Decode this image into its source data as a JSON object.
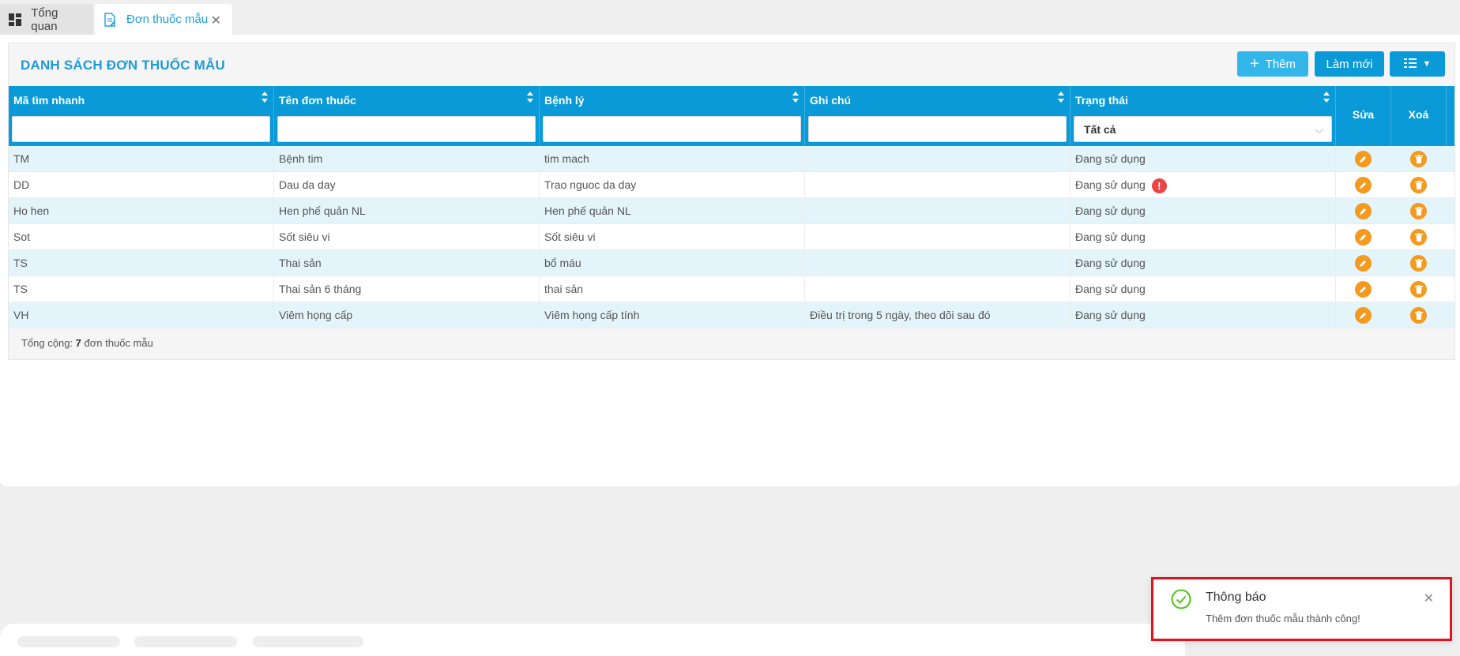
{
  "tabs": [
    {
      "label": "Tổng quan",
      "icon": "dashboard-icon"
    },
    {
      "label": "Đơn thuốc mẫu",
      "icon": "document-edit-icon",
      "active": true
    }
  ],
  "page": {
    "title": "DANH SÁCH ĐƠN THUỐC MẪU",
    "add_label": "Thêm",
    "refresh_label": "Làm mới"
  },
  "table": {
    "columns": {
      "code": "Mã tìm nhanh",
      "name": "Tên đơn thuốc",
      "disease": "Bệnh lý",
      "note": "Ghi chú",
      "status": "Trạng thái",
      "edit": "Sửa",
      "delete": "Xoá"
    },
    "status_filter": "Tất cả",
    "rows": [
      {
        "code": "TM",
        "name": "Bệnh tim",
        "disease": "tim mach",
        "note": "",
        "status": "Đang sử dụng",
        "warning": false
      },
      {
        "code": "DD",
        "name": "Dau da day",
        "disease": "Trao nguoc da day",
        "note": "",
        "status": "Đang sử dụng",
        "warning": true
      },
      {
        "code": "Ho hen",
        "name": "Hen phế quản NL",
        "disease": "Hen phế quản NL",
        "note": "",
        "status": "Đang sử dụng",
        "warning": false
      },
      {
        "code": "Sot",
        "name": "Sốt siêu vi",
        "disease": "Sốt siêu vi",
        "note": "",
        "status": "Đang sử dụng",
        "warning": false
      },
      {
        "code": "TS",
        "name": "Thai sản",
        "disease": "bổ máu",
        "note": "",
        "status": "Đang sử dụng",
        "warning": false
      },
      {
        "code": "TS",
        "name": "Thai sản 6 tháng",
        "disease": "thai sản",
        "note": "",
        "status": "Đang sử dụng",
        "warning": false
      },
      {
        "code": "VH",
        "name": "Viêm họng cấp",
        "disease": "Viêm họng cấp tính",
        "note": "Điều trị trong 5 ngày, theo dõi sau đó",
        "status": "Đang sử dụng",
        "warning": false
      }
    ],
    "footer": {
      "prefix": "Tổng cộng:",
      "count": "7",
      "suffix": "đơn thuốc mẫu"
    }
  },
  "toast": {
    "title": "Thông báo",
    "message": "Thêm đơn thuốc mẫu thành công!"
  },
  "colors": {
    "primary": "#0a9ad8",
    "accent_button": "#33b7ea",
    "action_orange": "#f39a1f",
    "warning_red": "#ee4544",
    "toast_border": "#e0141a"
  }
}
